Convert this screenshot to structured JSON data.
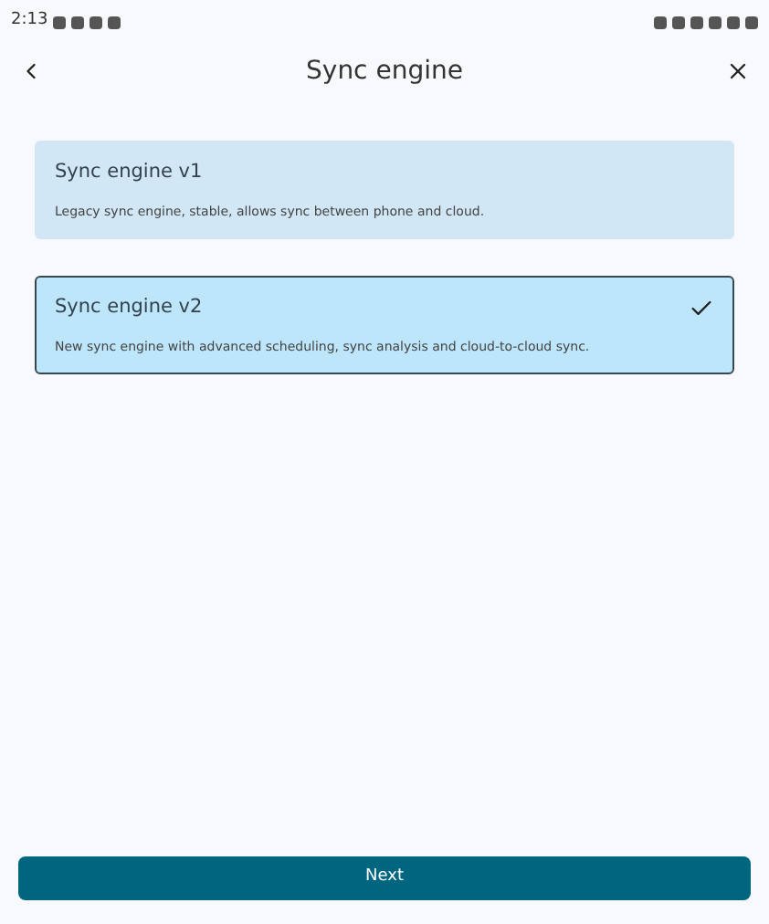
{
  "status_bar": {
    "time": "2:13"
  },
  "header": {
    "title": "Sync engine"
  },
  "options": [
    {
      "title": "Sync engine v1",
      "description": "Legacy sync engine, stable, allows sync between phone and cloud.",
      "selected": false
    },
    {
      "title": "Sync engine v2",
      "description": "New sync engine with advanced scheduling, sync analysis and cloud-to-cloud sync.",
      "selected": true
    }
  ],
  "button": {
    "label": "Next"
  }
}
